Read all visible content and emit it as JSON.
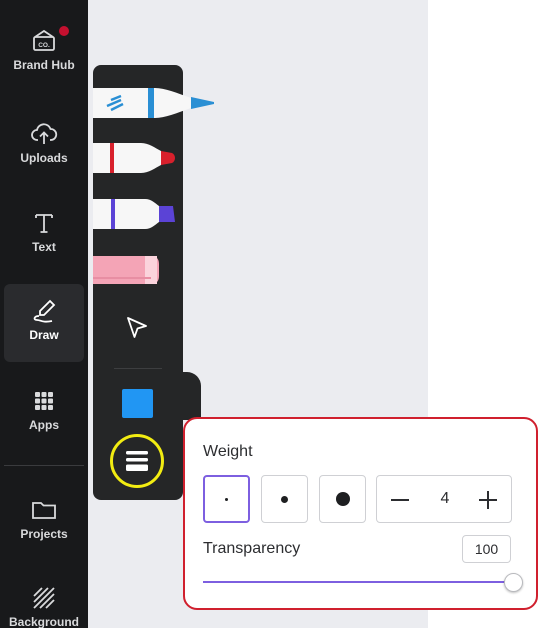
{
  "sidebar": {
    "items": [
      {
        "label": "Brand Hub",
        "icon": "brand-hub-icon"
      },
      {
        "label": "Uploads",
        "icon": "cloud-upload-icon"
      },
      {
        "label": "Text",
        "icon": "text-t-icon"
      },
      {
        "label": "Draw",
        "icon": "draw-squiggle-icon",
        "active": true
      },
      {
        "label": "Apps",
        "icon": "apps-grid-icon"
      },
      {
        "label": "Projects",
        "icon": "folder-icon"
      },
      {
        "label": "Background",
        "icon": "hatch-pattern-icon"
      }
    ],
    "brand_icon_text": "CO."
  },
  "draw_toolbar": {
    "tools": [
      "pen",
      "marker",
      "highlighter",
      "eraser",
      "select"
    ],
    "pen_color": "#2a8fd4",
    "marker_color": "#d8202c",
    "highlighter_color": "#5b43d6",
    "eraser_color": "#f4a4b6",
    "current_color": "#2196f3"
  },
  "settings_popover": {
    "weight_label": "Weight",
    "weight_options": [
      "small",
      "medium",
      "large"
    ],
    "selected_weight": "small",
    "weight_value": "4",
    "transparency_label": "Transparency",
    "transparency_value": "100",
    "transparency_level": 1.0,
    "accent_color": "#7d5fe0"
  }
}
